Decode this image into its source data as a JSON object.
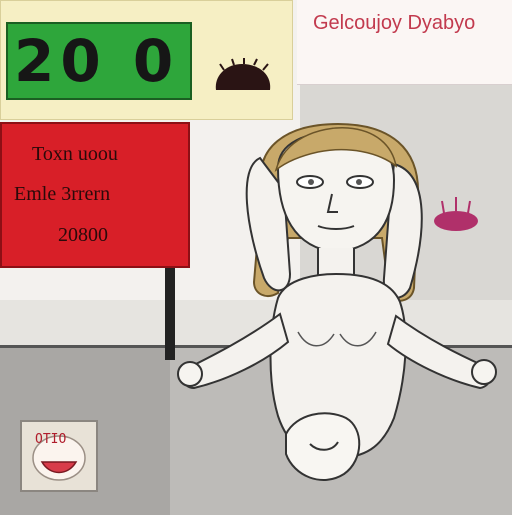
{
  "scoreboard": {
    "value": "20 0"
  },
  "banner": {
    "text": "Gelcoujoy Dyabyo"
  },
  "red_sign": {
    "line1": "Toxn  uoou",
    "line2": "Emle  3rrern",
    "line3": "20800"
  },
  "tile": {
    "text": "OTIO"
  },
  "colors": {
    "score_green": "#2ea63b",
    "sign_red": "#d81f28",
    "banner_text": "#c23a4e",
    "sign_yellow": "#f6efc4"
  },
  "icons": [
    "dark-blob-icon",
    "magenta-blob-icon",
    "face-tile-icon"
  ]
}
